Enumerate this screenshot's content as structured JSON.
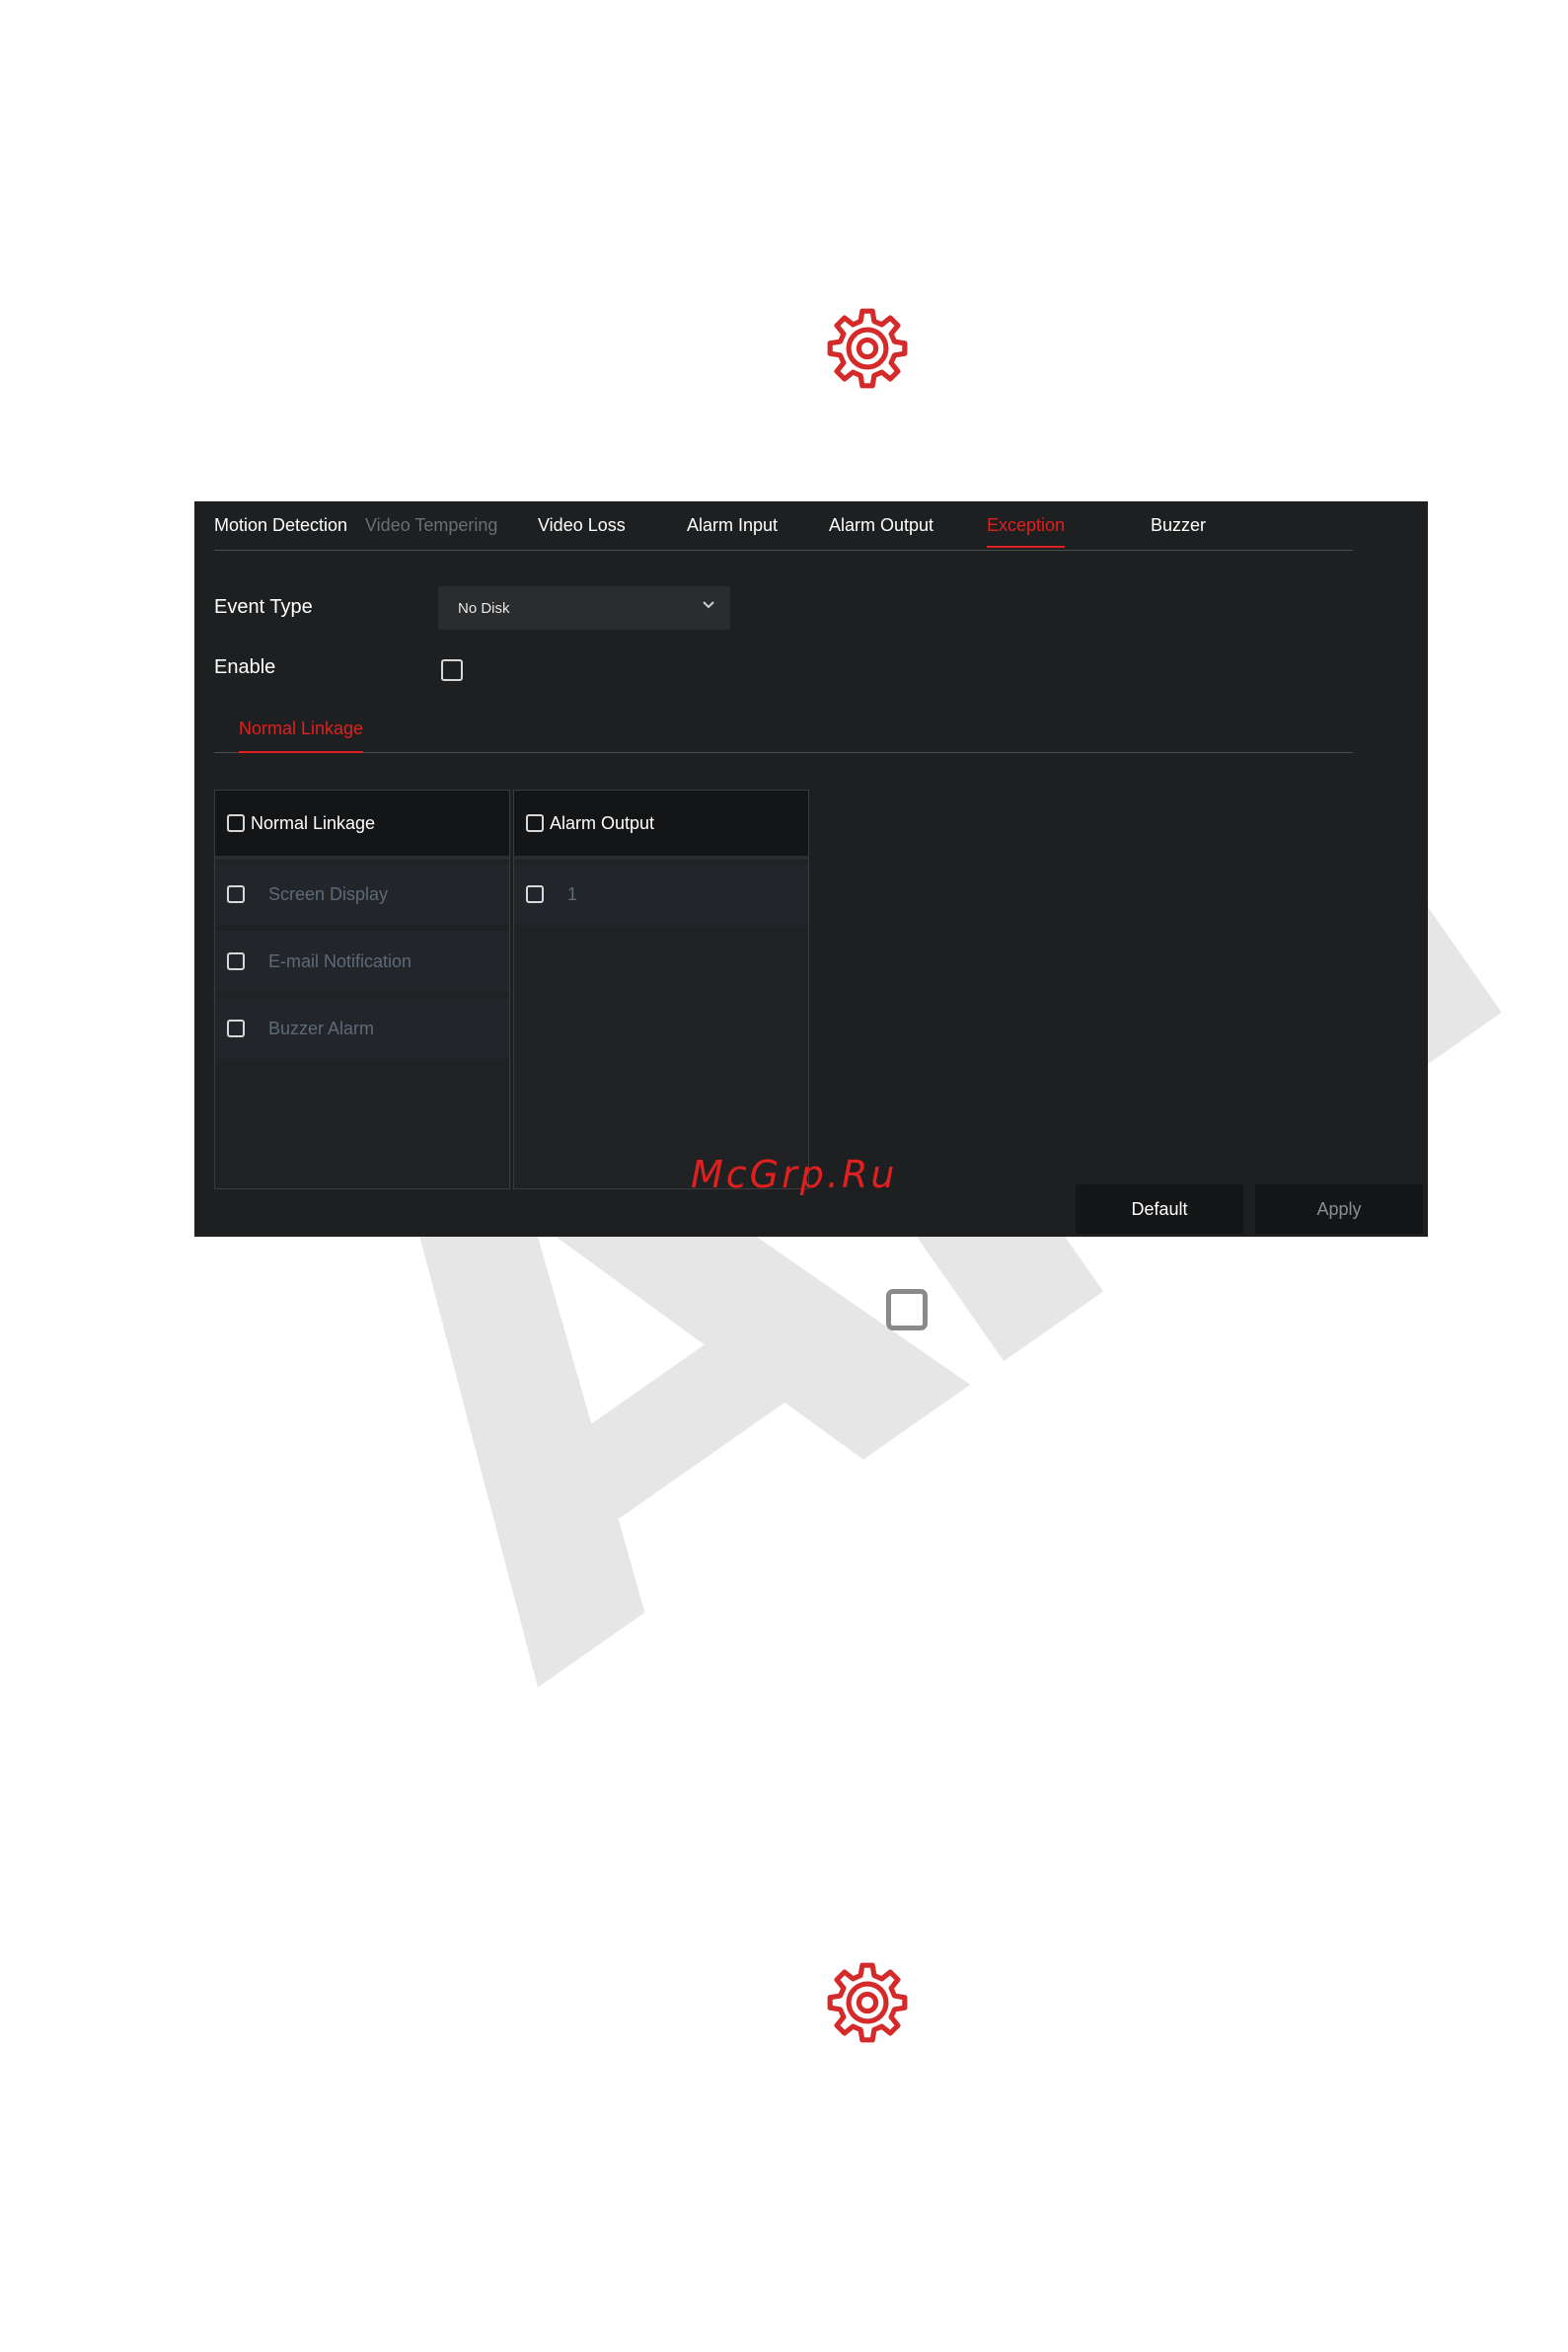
{
  "watermark": {
    "text": "Am"
  },
  "site_mark": "McGrp.Ru",
  "colors": {
    "accent": "#e0201f",
    "panel_bg": "#1d1f21",
    "gear": "#d42a2a"
  },
  "tabs": [
    {
      "label": "Motion Detection",
      "state": "normal"
    },
    {
      "label": "Video Tempering",
      "state": "disabled"
    },
    {
      "label": "Video Loss",
      "state": "normal"
    },
    {
      "label": "Alarm Input",
      "state": "normal"
    },
    {
      "label": "Alarm Output",
      "state": "normal"
    },
    {
      "label": "Exception",
      "state": "active"
    },
    {
      "label": "Buzzer",
      "state": "normal"
    }
  ],
  "form": {
    "event_type_label": "Event Type",
    "event_type_value": "No Disk",
    "enable_label": "Enable",
    "enable_checked": false
  },
  "subtab": {
    "label": "Normal Linkage"
  },
  "normal_linkage": {
    "header": "Normal Linkage",
    "items": [
      {
        "label": "Screen Display",
        "checked": false
      },
      {
        "label": "E-mail Notification",
        "checked": false
      },
      {
        "label": "Buzzer Alarm",
        "checked": false
      }
    ]
  },
  "alarm_output": {
    "header": "Alarm Output",
    "items": [
      {
        "label": "1",
        "checked": false
      }
    ]
  },
  "buttons": {
    "default_label": "Default",
    "apply_label": "Apply"
  },
  "icons": {
    "top": "gear-icon",
    "middle": "checkbox-icon",
    "bottom": "gear-icon"
  }
}
